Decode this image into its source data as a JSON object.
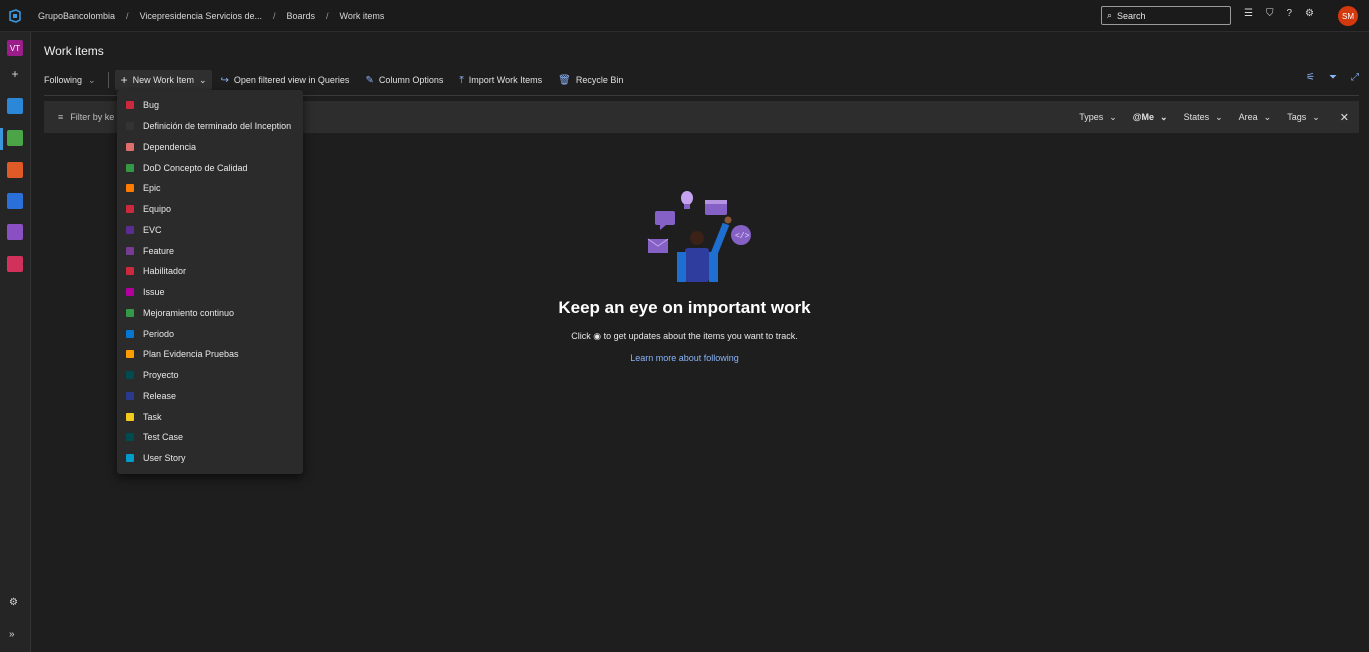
{
  "breadcrumb": [
    "GrupoBancolombia",
    "Vicepresidencia Servicios de...",
    "Boards",
    "Work items"
  ],
  "search": {
    "label": "Search"
  },
  "user": {
    "initials": "SM"
  },
  "nav": {
    "project_badge": "VT",
    "add": "+"
  },
  "page": {
    "title": "Work items"
  },
  "toolbar": {
    "following": "Following",
    "new_work_item": "New Work Item",
    "open_queries": "Open filtered view in Queries",
    "column_options": "Column Options",
    "import": "Import Work Items",
    "recycle": "Recycle Bin"
  },
  "filter": {
    "placeholder": "Filter by ke",
    "types": "Types",
    "me": "@Me",
    "states": "States",
    "area": "Area",
    "tags": "Tags"
  },
  "menu_items": [
    {
      "label": "Bug",
      "color": "#cc293d"
    },
    {
      "label": "Definición de terminado del Inception",
      "color": "#333333"
    },
    {
      "label": "Dependencia",
      "color": "#e06c6c"
    },
    {
      "label": "DoD Concepto de Calidad",
      "color": "#339947"
    },
    {
      "label": "Epic",
      "color": "#ff7b00"
    },
    {
      "label": "Equipo",
      "color": "#cc293d"
    },
    {
      "label": "EVC",
      "color": "#5c2d91"
    },
    {
      "label": "Feature",
      "color": "#773b93"
    },
    {
      "label": "Habilitador",
      "color": "#cc293d"
    },
    {
      "label": "Issue",
      "color": "#b4009e"
    },
    {
      "label": "Mejoramiento continuo",
      "color": "#339947"
    },
    {
      "label": "Periodo",
      "color": "#0078d4"
    },
    {
      "label": "Plan Evidencia Pruebas",
      "color": "#ff9d00"
    },
    {
      "label": "Proyecto",
      "color": "#004b50"
    },
    {
      "label": "Release",
      "color": "#2b3a8f"
    },
    {
      "label": "Task",
      "color": "#f2cb1d"
    },
    {
      "label": "Test Case",
      "color": "#004b50"
    },
    {
      "label": "User Story",
      "color": "#009ccc"
    }
  ],
  "empty_state": {
    "title": "Keep an eye on important work",
    "subtitle_pre": "Click",
    "subtitle_post": "to get updates about the items you want to track.",
    "link": "Learn more about following"
  }
}
